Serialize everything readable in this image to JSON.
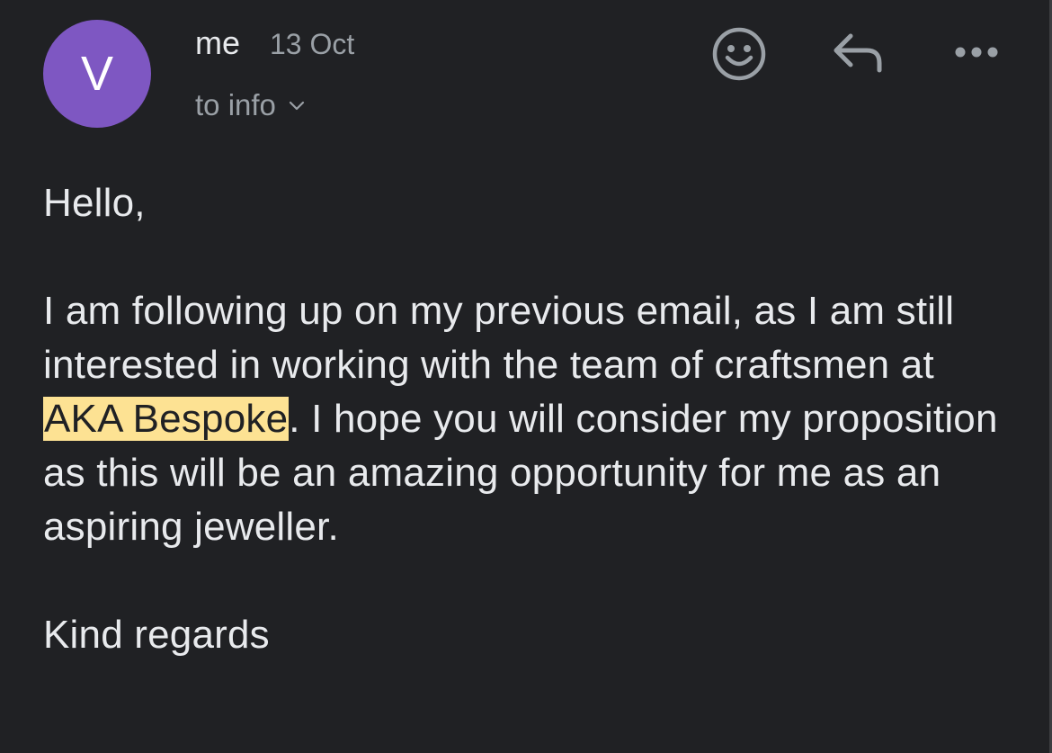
{
  "header": {
    "avatar_letter": "V",
    "avatar_color": "#7e57c2",
    "sender": "me",
    "date": "13 Oct",
    "recipient": "to info",
    "icons": [
      "emoji-reaction-icon",
      "reply-icon",
      "more-options-icon"
    ]
  },
  "body": {
    "greeting": "Hello,",
    "paragraph_before": "I am following up on my previous email, as I am still interested in working with the team of craftsmen at ",
    "highlight": "AKA Bespoke",
    "highlight_color": "#fde293",
    "paragraph_after": ". I hope you will consider my proposition as this will be an amazing opportunity for me as an aspiring jeweller.",
    "signoff": "Kind regards"
  },
  "theme": {
    "background": "#202124",
    "text": "#e8eaed",
    "muted": "#9aa0a6"
  }
}
